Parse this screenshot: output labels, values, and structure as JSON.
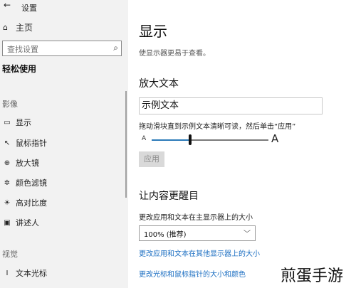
{
  "window": {
    "back_icon": "←",
    "title": "设置"
  },
  "sidebar": {
    "home": {
      "icon": "⌂",
      "label": "主页"
    },
    "search": {
      "placeholder": "查找设置",
      "icon": "⌕"
    },
    "section_title": "轻松使用",
    "group_vision": "影像",
    "items": [
      {
        "icon": "▭",
        "label": "显示"
      },
      {
        "icon": "↖",
        "label": "鼠标指针"
      },
      {
        "icon": "⊕",
        "label": "放大镜"
      },
      {
        "icon": "✲",
        "label": "颜色滤镜"
      },
      {
        "icon": "☀",
        "label": "高对比度"
      },
      {
        "icon": "▣",
        "label": "讲述人"
      }
    ],
    "group_hearing": "视觉",
    "items2": [
      {
        "icon": "I",
        "label": "文本光标"
      }
    ]
  },
  "main": {
    "title": "显示",
    "description": "使显示器更易于查看。",
    "enlarge_heading": "放大文本",
    "sample_text": "示例文本",
    "slider_hint": "拖动滑块直到示例文本清晰可读，然后单击“应用”",
    "slider_small_label": "A",
    "slider_large_label": "A",
    "slider_value_fraction": 0.33,
    "apply_button": "应用",
    "bigger_heading": "让内容更醒目",
    "scale_label": "更改应用和文本在主显示器上的大小",
    "scale_value": "100% (推荐)",
    "link_other_displays": "更改应用和文本在其他显示器上的大小",
    "link_cursor": "更改光标和鼠标指针的大小和颜色"
  },
  "watermark": "煎蛋手游",
  "colors": {
    "sidebar_bg": "#f2f2f2",
    "accent": "#2a7ab8",
    "link": "#1b6ec2"
  }
}
